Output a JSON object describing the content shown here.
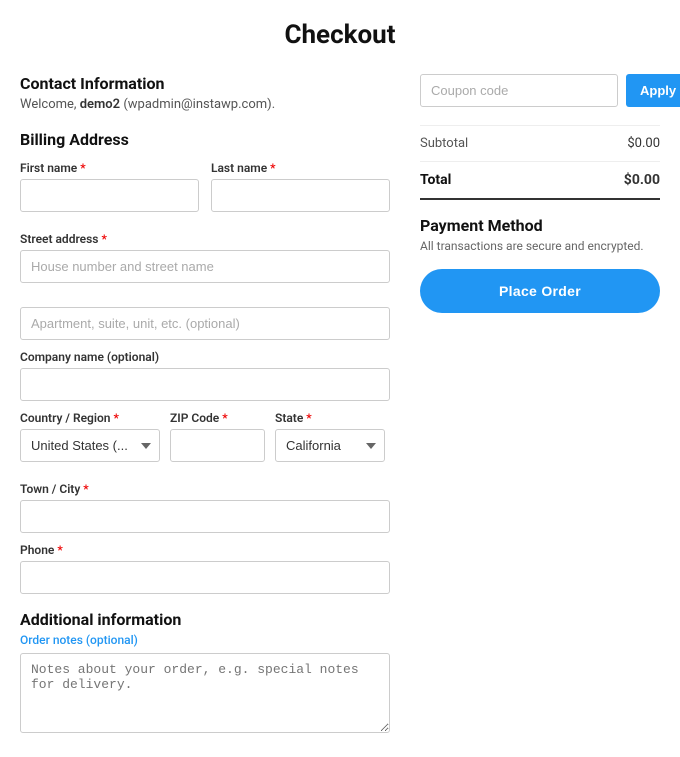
{
  "page": {
    "title": "Checkout"
  },
  "contact": {
    "section_title": "Contact Information",
    "welcome_text": "Welcome,",
    "username": "demo2",
    "email": "wpadmin@instawp.com"
  },
  "billing": {
    "section_title": "Billing Address",
    "first_name_label": "First name",
    "last_name_label": "Last name",
    "street_address_label": "Street address",
    "street_placeholder": "House number and street name",
    "apartment_placeholder": "Apartment, suite, unit, etc. (optional)",
    "company_label": "Company name (optional)",
    "country_label": "Country / Region",
    "country_value": "United States (...",
    "zip_label": "ZIP Code",
    "state_label": "State",
    "state_value": "California",
    "town_label": "Town / City",
    "phone_label": "Phone",
    "required_marker": "*"
  },
  "additional": {
    "section_title": "Additional information",
    "notes_label": "Order notes (optional)",
    "notes_placeholder": "Notes about your order, e.g. special notes for delivery."
  },
  "coupon": {
    "placeholder": "Coupon code",
    "button_label": "Apply Coupon"
  },
  "order_summary": {
    "subtotal_label": "Subtotal",
    "subtotal_value": "$0.00",
    "total_label": "Total",
    "total_value": "$0.00"
  },
  "payment": {
    "section_title": "Payment Method",
    "secure_text": "All transactions are secure and encrypted.",
    "place_order_label": "Place Order"
  },
  "country_options": [
    "United States (..."
  ],
  "state_options": [
    "California"
  ]
}
